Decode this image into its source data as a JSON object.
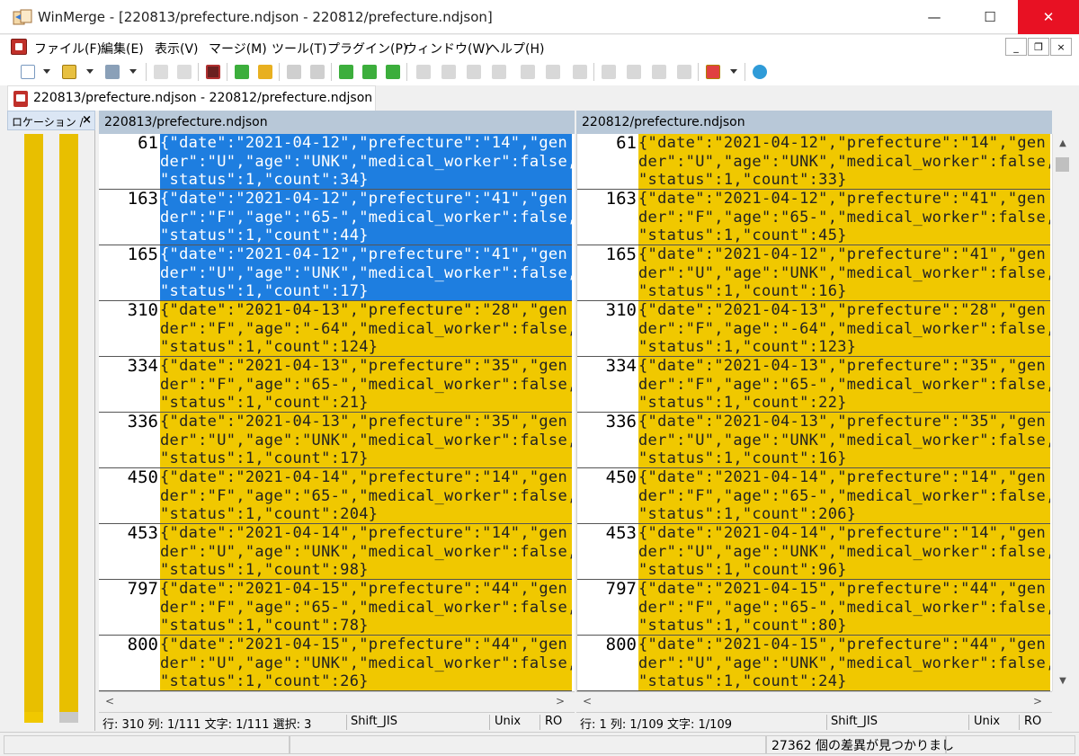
{
  "window": {
    "title": "WinMerge - [220813/prefecture.ndjson - 220812/prefecture.ndjson]",
    "min_glyph": "—",
    "max_glyph": "☐",
    "close_glyph": "✕"
  },
  "menu": [
    "ファイル(F)",
    "編集(E)",
    "表示(V)",
    "マージ(M)",
    "ツール(T)",
    "プラグイン(P)",
    "ウィンドウ(W)",
    "ヘルプ(H)"
  ],
  "mdi": {
    "min": "_",
    "restore": "❐",
    "close": "×"
  },
  "tab": {
    "label": "220813/prefecture.ndjson - 220812/prefecture.ndjson"
  },
  "location_pane": {
    "title": "ロケーション /",
    "close": "×"
  },
  "colors": {
    "diff": "#f0c800",
    "selected": "#1e7ee0",
    "header": "#b8c8d8"
  },
  "left": {
    "header": "220813/prefecture.ndjson",
    "lines": [
      {
        "num": "61",
        "text": "{\"date\":\"2021-04-12\",\"prefecture\":\"14\",\"gen\nder\":\"U\",\"age\":\"UNK\",\"medical_worker\":false,\n\"status\":1,\"count\":34}",
        "state": "sel"
      },
      {
        "num": "163",
        "text": "{\"date\":\"2021-04-12\",\"prefecture\":\"41\",\"gen\nder\":\"F\",\"age\":\"65-\",\"medical_worker\":false,\n\"status\":1,\"count\":44}",
        "state": "sel"
      },
      {
        "num": "165",
        "text": "{\"date\":\"2021-04-12\",\"prefecture\":\"41\",\"gen\nder\":\"U\",\"age\":\"UNK\",\"medical_worker\":false,\n\"status\":1,\"count\":17}",
        "state": "sel"
      },
      {
        "num": "310",
        "text": "{\"date\":\"2021-04-13\",\"prefecture\":\"28\",\"gen\nder\":\"F\",\"age\":\"-64\",\"medical_worker\":false,\n\"status\":1,\"count\":124}",
        "state": "diff"
      },
      {
        "num": "334",
        "text": "{\"date\":\"2021-04-13\",\"prefecture\":\"35\",\"gen\nder\":\"F\",\"age\":\"65-\",\"medical_worker\":false,\n\"status\":1,\"count\":21}",
        "state": "diff"
      },
      {
        "num": "336",
        "text": "{\"date\":\"2021-04-13\",\"prefecture\":\"35\",\"gen\nder\":\"U\",\"age\":\"UNK\",\"medical_worker\":false,\n\"status\":1,\"count\":17}",
        "state": "diff"
      },
      {
        "num": "450",
        "text": "{\"date\":\"2021-04-14\",\"prefecture\":\"14\",\"gen\nder\":\"F\",\"age\":\"65-\",\"medical_worker\":false,\n\"status\":1,\"count\":204}",
        "state": "diff"
      },
      {
        "num": "453",
        "text": "{\"date\":\"2021-04-14\",\"prefecture\":\"14\",\"gen\nder\":\"U\",\"age\":\"UNK\",\"medical_worker\":false,\n\"status\":1,\"count\":98}",
        "state": "diff"
      },
      {
        "num": "797",
        "text": "{\"date\":\"2021-04-15\",\"prefecture\":\"44\",\"gen\nder\":\"F\",\"age\":\"65-\",\"medical_worker\":false,\n\"status\":1,\"count\":78}",
        "state": "diff"
      },
      {
        "num": "800",
        "text": "{\"date\":\"2021-04-15\",\"prefecture\":\"44\",\"gen\nder\":\"U\",\"age\":\"UNK\",\"medical_worker\":false,\n\"status\":1,\"count\":26}",
        "state": "diff"
      }
    ],
    "status": {
      "pos": "行: 310  列: 1/111  文字: 1/111  選択: 3",
      "encoding": "Shift_JIS",
      "eol": "Unix",
      "mode": "RO"
    }
  },
  "right": {
    "header": "220812/prefecture.ndjson",
    "lines": [
      {
        "num": "61",
        "text": "{\"date\":\"2021-04-12\",\"prefecture\":\"14\",\"gen\nder\":\"U\",\"age\":\"UNK\",\"medical_worker\":false,\n\"status\":1,\"count\":33}",
        "state": "diff"
      },
      {
        "num": "163",
        "text": "{\"date\":\"2021-04-12\",\"prefecture\":\"41\",\"gen\nder\":\"F\",\"age\":\"65-\",\"medical_worker\":false,\n\"status\":1,\"count\":45}",
        "state": "diff"
      },
      {
        "num": "165",
        "text": "{\"date\":\"2021-04-12\",\"prefecture\":\"41\",\"gen\nder\":\"U\",\"age\":\"UNK\",\"medical_worker\":false,\n\"status\":1,\"count\":16}",
        "state": "diff"
      },
      {
        "num": "310",
        "text": "{\"date\":\"2021-04-13\",\"prefecture\":\"28\",\"gen\nder\":\"F\",\"age\":\"-64\",\"medical_worker\":false,\n\"status\":1,\"count\":123}",
        "state": "diff"
      },
      {
        "num": "334",
        "text": "{\"date\":\"2021-04-13\",\"prefecture\":\"35\",\"gen\nder\":\"F\",\"age\":\"65-\",\"medical_worker\":false,\n\"status\":1,\"count\":22}",
        "state": "diff"
      },
      {
        "num": "336",
        "text": "{\"date\":\"2021-04-13\",\"prefecture\":\"35\",\"gen\nder\":\"U\",\"age\":\"UNK\",\"medical_worker\":false,\n\"status\":1,\"count\":16}",
        "state": "diff"
      },
      {
        "num": "450",
        "text": "{\"date\":\"2021-04-14\",\"prefecture\":\"14\",\"gen\nder\":\"F\",\"age\":\"65-\",\"medical_worker\":false,\n\"status\":1,\"count\":206}",
        "state": "diff"
      },
      {
        "num": "453",
        "text": "{\"date\":\"2021-04-14\",\"prefecture\":\"14\",\"gen\nder\":\"U\",\"age\":\"UNK\",\"medical_worker\":false,\n\"status\":1,\"count\":96}",
        "state": "diff"
      },
      {
        "num": "797",
        "text": "{\"date\":\"2021-04-15\",\"prefecture\":\"44\",\"gen\nder\":\"F\",\"age\":\"65-\",\"medical_worker\":false,\n\"status\":1,\"count\":80}",
        "state": "diff"
      },
      {
        "num": "800",
        "text": "{\"date\":\"2021-04-15\",\"prefecture\":\"44\",\"gen\nder\":\"U\",\"age\":\"UNK\",\"medical_worker\":false,\n\"status\":1,\"count\":24}",
        "state": "diff"
      }
    ],
    "status": {
      "pos": "行: 1  列: 1/109  文字: 1/109",
      "encoding": "Shift_JIS",
      "eol": "Unix",
      "mode": "RO"
    }
  },
  "scroll": {
    "left": "<",
    "right": ">",
    "up": "▲",
    "down": "▼"
  },
  "statusbar": {
    "message": "27362 個の差異が見つかりまし"
  }
}
